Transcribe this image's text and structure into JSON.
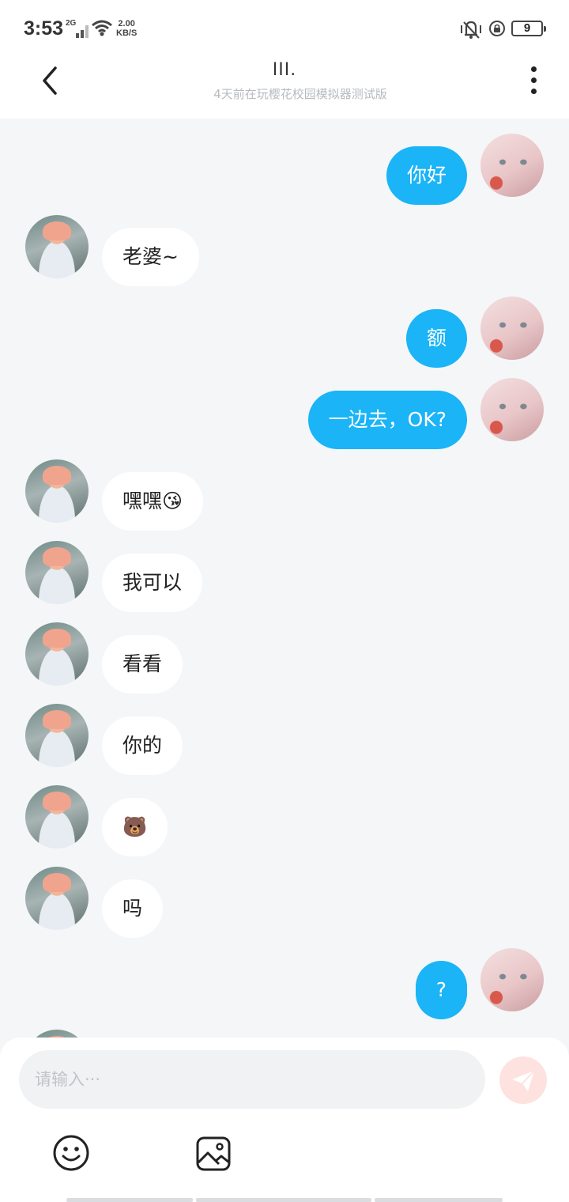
{
  "status": {
    "time": "3:53",
    "network": "2G",
    "speed_value": "2.00",
    "speed_unit": "KB/S",
    "battery": "9"
  },
  "header": {
    "title": "III.",
    "subtitle": "4天前在玩樱花校园模拟器测试版",
    "back_icon": "chevron-left-icon",
    "more_icon": "vertical-dots-icon"
  },
  "messages": [
    {
      "side": "right",
      "text": "你好"
    },
    {
      "side": "left",
      "text": "老婆~"
    },
    {
      "side": "right",
      "text": "额"
    },
    {
      "side": "right",
      "text": "一边去，OK?"
    },
    {
      "side": "left",
      "text": "嘿嘿😘"
    },
    {
      "side": "left",
      "text": "我可以"
    },
    {
      "side": "left",
      "text": "看看"
    },
    {
      "side": "left",
      "text": "你的"
    },
    {
      "side": "left",
      "text": "🐻"
    },
    {
      "side": "left",
      "text": "吗"
    },
    {
      "side": "right",
      "text": "?"
    }
  ],
  "input": {
    "placeholder": "请输入···",
    "send_icon": "send-plane-icon",
    "emoji_icon": "smiley-icon",
    "image_icon": "image-icon"
  },
  "colors": {
    "outgoing_bubble": "#1ab4f7",
    "incoming_bubble": "#ffffff",
    "background": "#f4f6f8",
    "send_button": "#fde2df"
  }
}
